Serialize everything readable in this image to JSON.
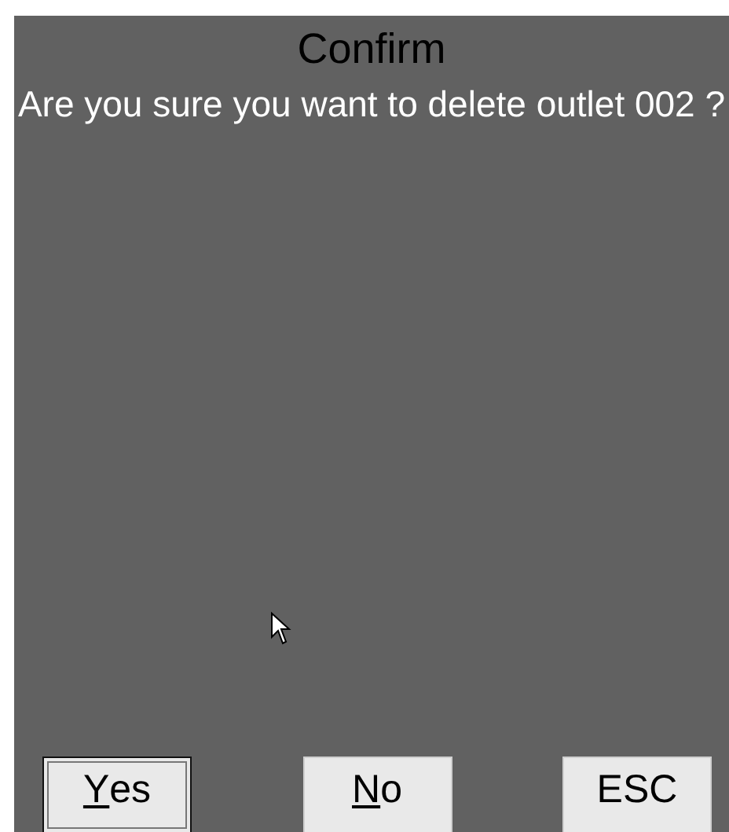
{
  "dialog": {
    "title": "Confirm",
    "message": "Are you sure you want to delete outlet 002 ?"
  },
  "buttons": [
    {
      "label": "Yes",
      "focused": true,
      "underline_first": true
    },
    {
      "label": "No",
      "focused": false,
      "underline_first": true
    },
    {
      "label": "ESC",
      "focused": false,
      "underline_first": false
    }
  ]
}
